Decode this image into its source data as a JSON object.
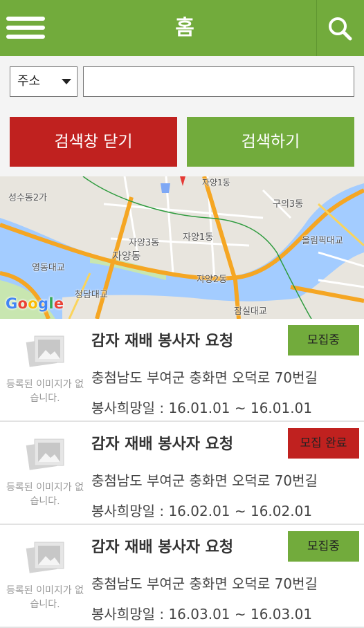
{
  "header": {
    "title": "홈"
  },
  "search": {
    "select_value": "주소",
    "input_value": "",
    "close_label": "검색창 닫기",
    "search_label": "검색하기"
  },
  "map": {
    "labels": {
      "seongsu": "성수동2가",
      "jayang3": "자양3동",
      "jayang1": "자양1동",
      "jayang": "자양동",
      "guui3": "구의3동",
      "olympic": "올림픽대교",
      "yeongdong": "영동대교",
      "cheongdam": "청담대교",
      "jayang2": "자양2동",
      "jamsil": "잠실대교",
      "top": "자양1동"
    },
    "logo": "Google",
    "colors": {
      "water": "#a3ccff",
      "land": "#e8e5de",
      "road": "#f5a623"
    }
  },
  "list": {
    "no_image_text": "등록된 이미지가 없습니다.",
    "items": [
      {
        "title": "감자 재배 봉사자 요청",
        "badge": "모집중",
        "status": "open",
        "address": "충첨남도 부여군 충화면 오덕로 70번길",
        "date": "봉사희망일 : 16.01.01 ~ 16.01.01"
      },
      {
        "title": "감자 재배 봉사자 요청",
        "badge": "모집 완료",
        "status": "done",
        "address": "충첨남도 부여군 충화면 오덕로 70번길",
        "date": "봉사희망일 : 16.02.01 ~ 16.02.01"
      },
      {
        "title": "감자 재배 봉사자 요청",
        "badge": "모집중",
        "status": "open",
        "address": "충첨남도 부여군 충화면 오덕로 70번길",
        "date": "봉사희망일 : 16.03.01 ~ 16.03.01"
      }
    ]
  },
  "theme": {
    "green": "#72ab3c",
    "red": "#c0211f"
  }
}
